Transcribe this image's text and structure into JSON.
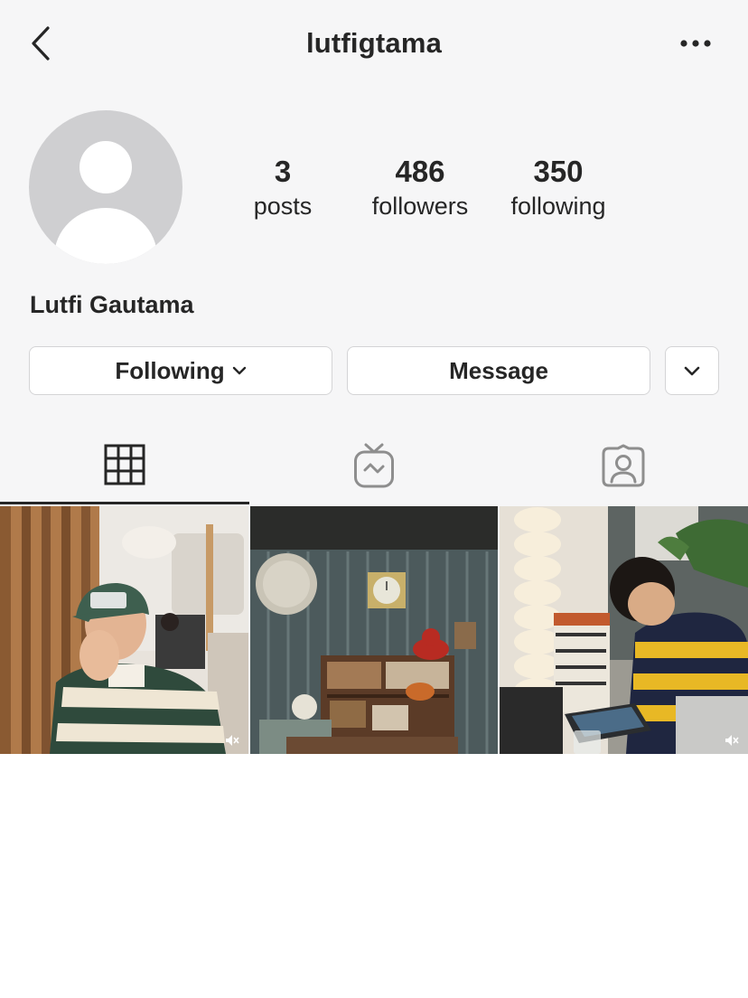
{
  "header": {
    "username": "lutfigtama",
    "back_icon": "chevron-left-icon",
    "more_icon": "ellipsis-icon"
  },
  "profile": {
    "avatar_icon": "default-avatar-icon",
    "display_name": "Lutfi Gautama",
    "stats": [
      {
        "value": "3",
        "label": "posts"
      },
      {
        "value": "486",
        "label": "followers"
      },
      {
        "value": "350",
        "label": "following"
      }
    ]
  },
  "actions": {
    "following_label": "Following",
    "message_label": "Message",
    "more_icon": "chevron-down-icon"
  },
  "tabs": [
    {
      "name": "posts-grid",
      "icon": "grid-icon",
      "active": true
    },
    {
      "name": "igtv",
      "icon": "igtv-icon",
      "active": false
    },
    {
      "name": "tagged",
      "icon": "tagged-user-icon",
      "active": false
    }
  ],
  "posts": [
    {
      "type": "photo",
      "muted_icon": "audio-muted-icon"
    },
    {
      "type": "photo"
    },
    {
      "type": "photo",
      "muted_icon": "audio-muted-icon"
    }
  ],
  "colors": {
    "background": "#f6f6f7",
    "text": "#262626",
    "border": "#d4d4d6",
    "avatar": "#cfcfd1"
  }
}
